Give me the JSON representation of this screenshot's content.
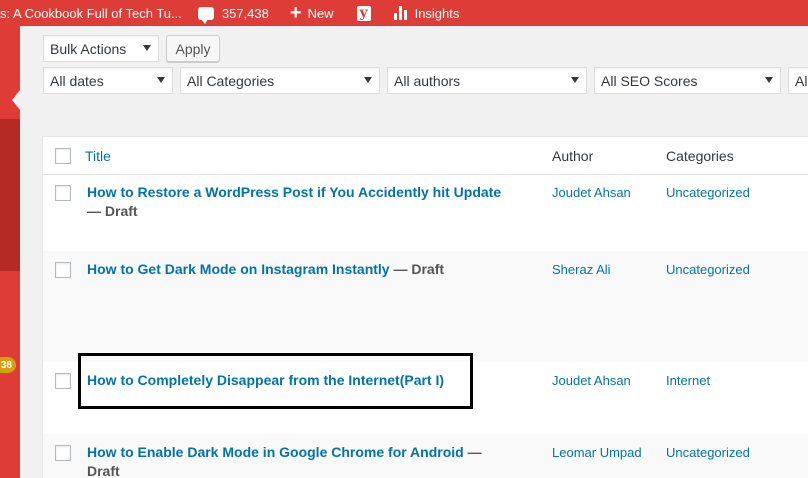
{
  "adminbar": {
    "site_name": "s: A Cookbook Full of Tech Tu...",
    "comments_count": "357,438",
    "new_label": "New",
    "insights_label": "Insights"
  },
  "sidemenu": {
    "badge": "38"
  },
  "toolbar": {
    "bulk_actions": "Bulk Actions",
    "apply": "Apply",
    "dates": "All dates",
    "categories": "All Categories",
    "authors": "All authors",
    "seo": "All SEO Scores",
    "readability_partial": "All"
  },
  "table": {
    "headers": {
      "title": "Title",
      "author": "Author",
      "categories": "Categories"
    },
    "rows": [
      {
        "title": "How to Restore a WordPress Post if You Accidently hit Update",
        "state": " — Draft",
        "author": "Joudet Ahsan",
        "category": "Uncategorized"
      },
      {
        "title": "How to Get Dark Mode on Instagram Instantly",
        "state": " — Draft",
        "author": "Sheraz Ali",
        "category": "Uncategorized"
      },
      {
        "title": "How to Completely Disappear from the Internet(Part I)",
        "state": "",
        "author": "Joudet Ahsan",
        "category": "Internet"
      },
      {
        "title": "How to Enable Dark Mode in Google Chrome for Android",
        "state": " — Draft",
        "author": "Leomar Umpad",
        "category": "Uncategorized"
      }
    ]
  },
  "colors": {
    "adminbar": "#dd3d36",
    "link": "#0073aa",
    "highlight_border": "#000000"
  }
}
